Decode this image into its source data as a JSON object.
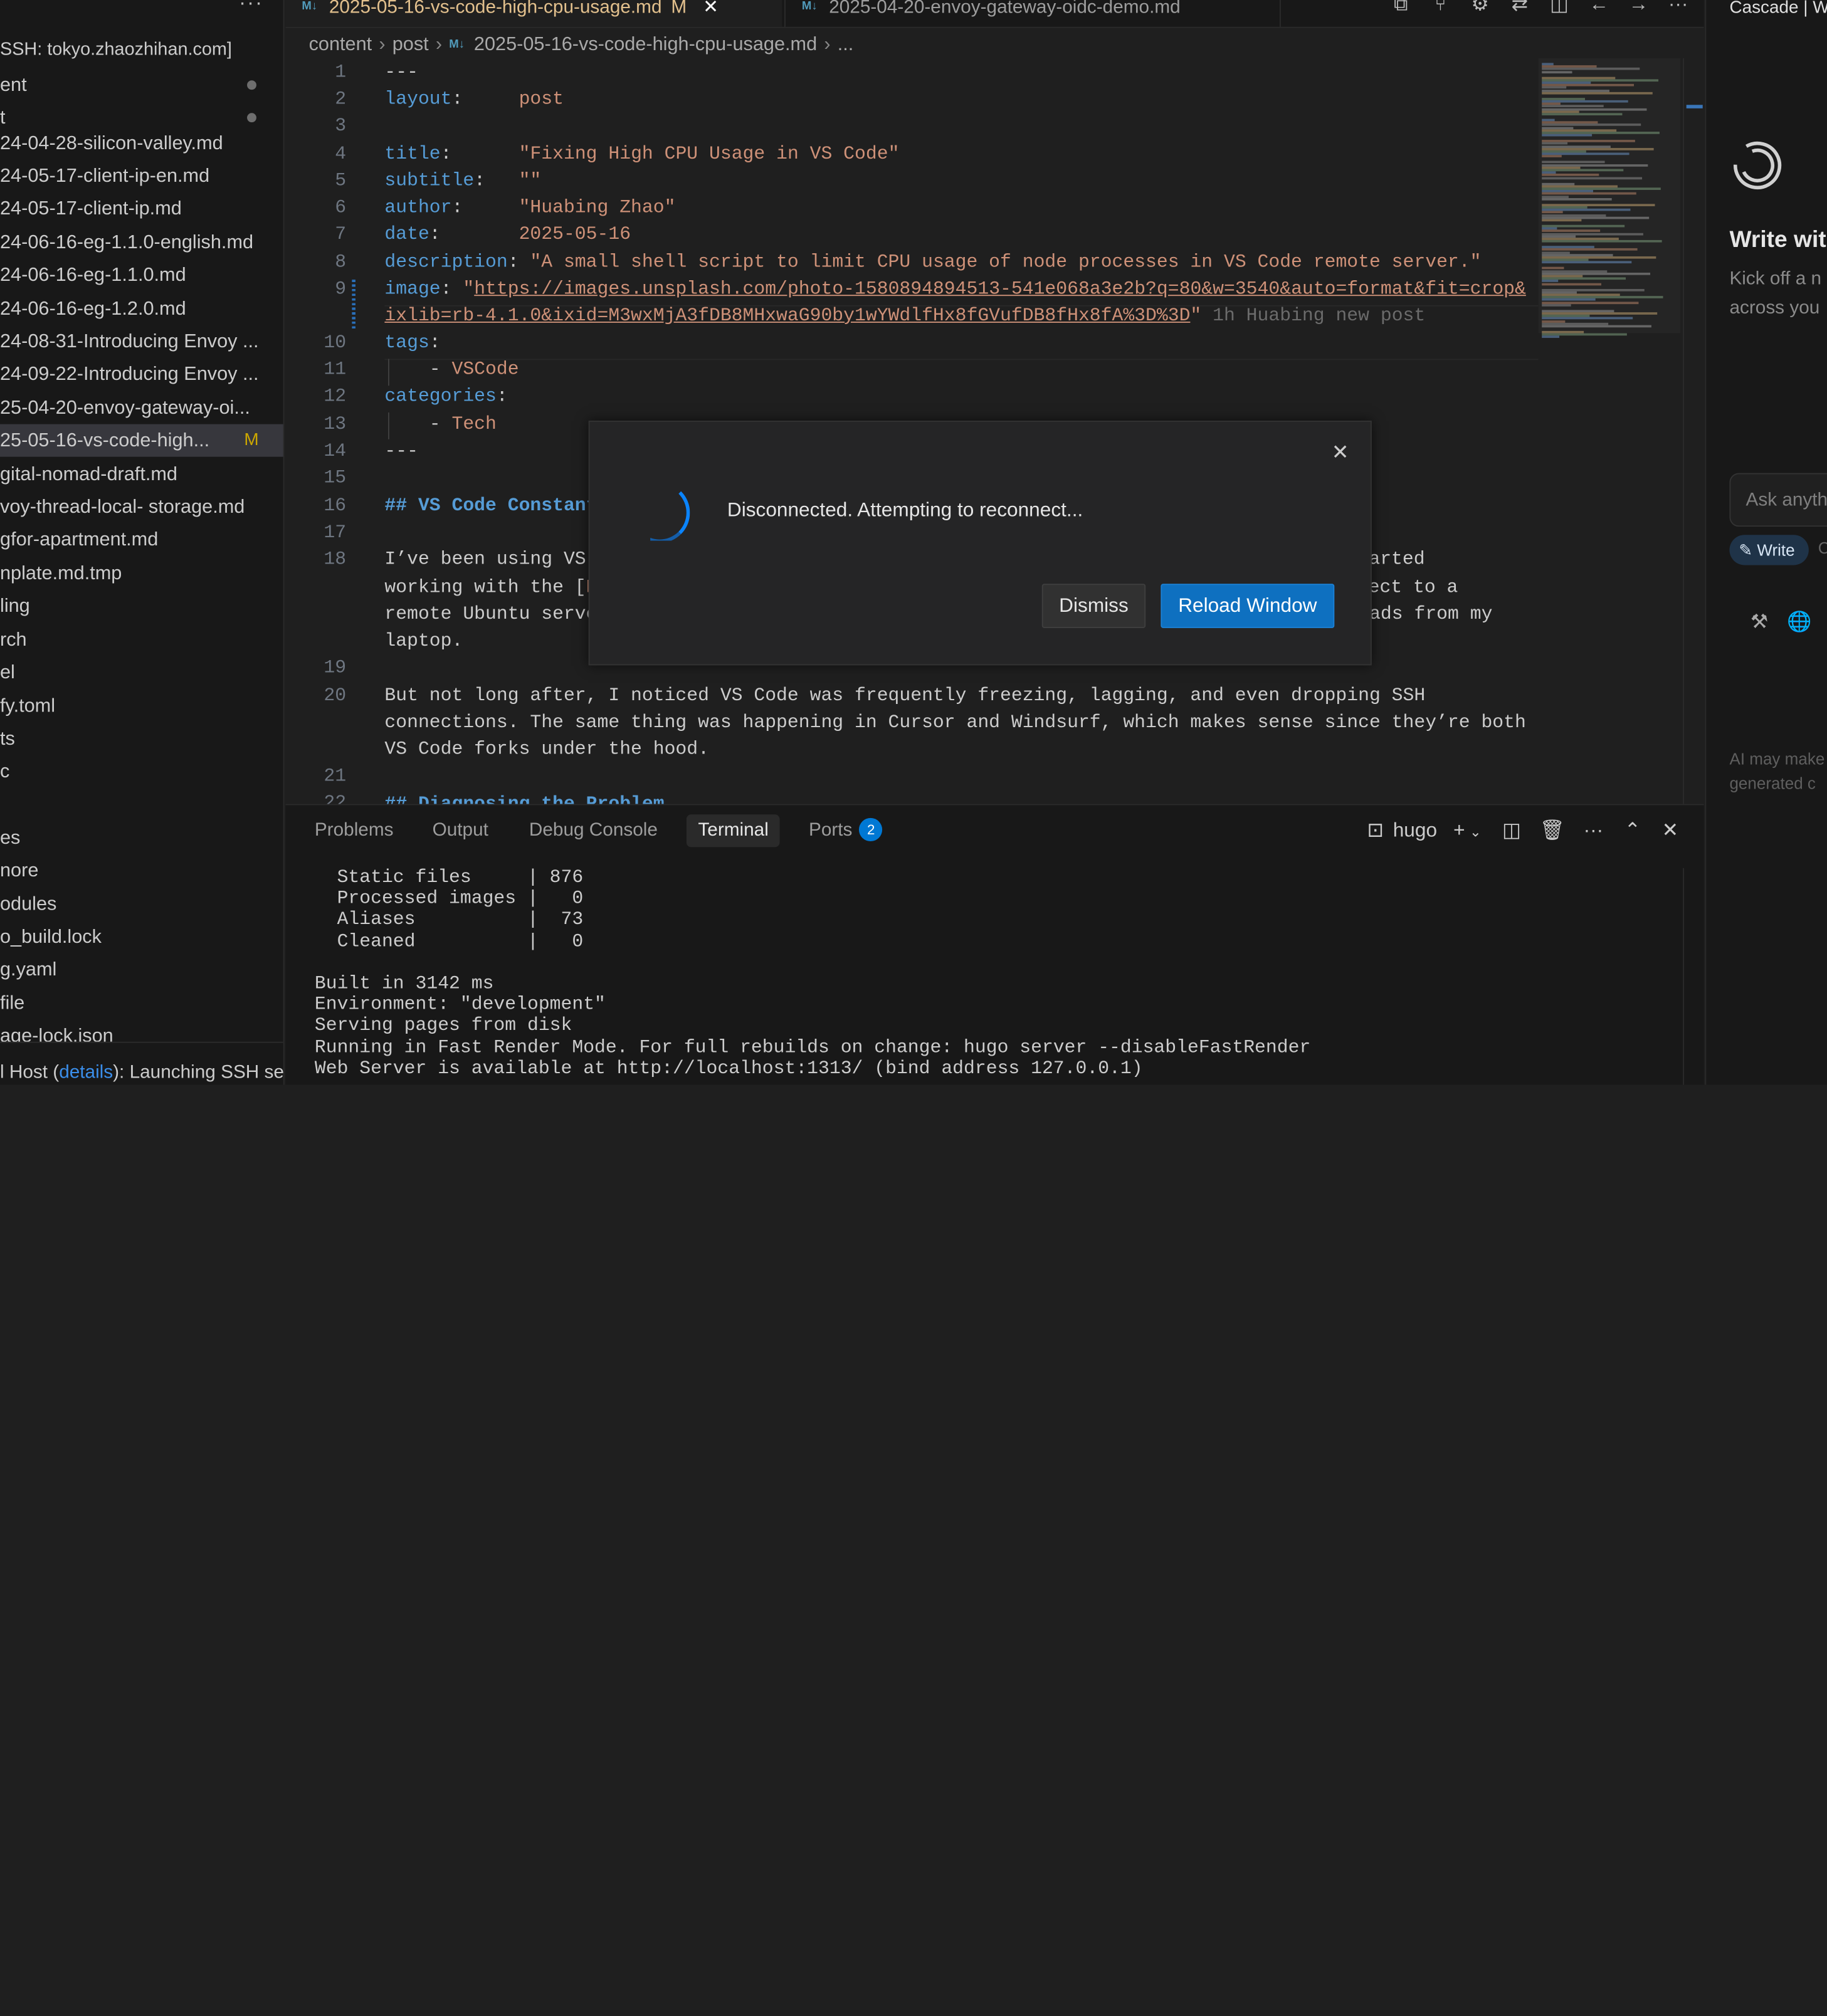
{
  "sidebar": {
    "title": "SSH: tokyo.zhaozhihan.com]",
    "items": [
      {
        "label": "ent"
      },
      {
        "label": "t"
      },
      {
        "label": "24-04-28-silicon-valley.md"
      },
      {
        "label": "24-05-17-client-ip-en.md"
      },
      {
        "label": "24-05-17-client-ip.md"
      },
      {
        "label": "24-06-16-eg-1.1.0-english.md"
      },
      {
        "label": "24-06-16-eg-1.1.0.md"
      },
      {
        "label": "24-06-16-eg-1.2.0.md"
      },
      {
        "label": "24-08-31-Introducing Envoy ..."
      },
      {
        "label": "24-09-22-Introducing Envoy ..."
      },
      {
        "label": "25-04-20-envoy-gateway-oi..."
      },
      {
        "label": "25-05-16-vs-code-high...",
        "badge": "M"
      },
      {
        "label": "gital-nomad-draft.md"
      },
      {
        "label": "voy-thread-local- storage.md"
      },
      {
        "label": "gfor-apartment.md"
      },
      {
        "label": "nplate.md.tmp"
      },
      {
        "label": "ling"
      },
      {
        "label": "rch"
      },
      {
        "label": "el"
      },
      {
        "label": "fy.toml"
      },
      {
        "label": "ts"
      },
      {
        "label": "c"
      },
      {
        "label": "es"
      },
      {
        "label": "nore"
      },
      {
        "label": "odules"
      },
      {
        "label": "o_build.lock"
      },
      {
        "label": "g.yaml"
      },
      {
        "label": "file"
      },
      {
        "label": "age-lock.json"
      }
    ],
    "status_prefix": "l Host (",
    "status_link": "details",
    "status_suffix": "): Launching SSH server..."
  },
  "tabs": [
    {
      "icon": "M↓",
      "label": "2025-05-16-vs-code-high-cpu-usage.md",
      "modified": "M",
      "close": "✕"
    },
    {
      "icon": "M↓",
      "label": "2025-04-20-envoy-gateway-oidc-demo.md"
    }
  ],
  "breadcrumb": {
    "parts": [
      "content",
      "post"
    ],
    "file": "2025-05-16-vs-code-high-cpu-usage.md",
    "tail": "..."
  },
  "editor": {
    "line_numbers": [
      "1",
      "2",
      "3",
      "4",
      "5",
      "6",
      "7",
      "8",
      "9",
      "10",
      "11",
      "12",
      "13",
      "14",
      "15",
      "16",
      "17",
      "18",
      "19",
      "20",
      "21",
      "22"
    ],
    "l1": "---",
    "l2_key": "layout",
    "l2_val": "post",
    "l4_key": "title",
    "l4_val": "\"Fixing High CPU Usage in VS Code\"",
    "l5_key": "subtitle",
    "l5_val": "\"\"",
    "l6_key": "author",
    "l6_val": "\"Huabing Zhao\"",
    "l7_key": "date",
    "l7_val": "2025-05-16",
    "l8_key": "description",
    "l8_val": "\"A small shell script to limit CPU usage of node processes in VS Code remote server.\"",
    "l9_key": "image",
    "l9_url1": "https://images.unsplash.com/photo-1580894894513-541e068a3e2b?q=80&w=3540&auto=format&fit=crop&",
    "l9_url2": "ixlib=rb-4.1.0&ixid=M3wxMjA3fDB8MHxwaG90by1wYWdlfHx8fGVufDB8fHx8fA%3D%3D",
    "l9_blame": "1h Huabing new post",
    "l10_key": "tags",
    "l11_val": "VSCode",
    "l12_key": "categories",
    "l13_val": "Tech",
    "l14": "---",
    "l16": "## VS Code Constant",
    "l18a_pre": "I’ve been using VS",
    "l18a_post": "tarted",
    "l18b_pre": "working with the [",
    "l18b_mid": "R",
    "l18b_post": "nnect to a",
    "l18c_pre": "remote Ubuntu serve",
    "l18c_post": "ads from my",
    "l18d": "laptop.",
    "l20a": "But not long after, I noticed VS Code was frequently freezing, lagging, and even dropping SSH",
    "l20b": "connections. The same thing was happening in Cursor and Windsurf, which makes sense since they’re both",
    "l20c": "VS Code forks under the hood.",
    "l22": "## Diagnosing the Problem"
  },
  "panel": {
    "tabs": [
      "Problems",
      "Output",
      "Debug Console",
      "Terminal",
      "Ports"
    ],
    "ports_count": "2",
    "terminal_name": "hugo",
    "terminal_text": "  Static files     | 876\n  Processed images |   0\n  Aliases          |  73\n  Cleaned          |   0\n\nBuilt in 3142 ms\nEnvironment: \"development\"\nServing pages from disk\nRunning in Fast Render Mode. For full rebuilds on change: hugo server --disableFastRender\nWeb Server is available at http://localhost:1313/ (bind address 127.0.0.1)"
  },
  "right_pane": {
    "title": "Cascade | W",
    "heading": "Write wit",
    "sub1": "Kick off a n",
    "sub2": "across you",
    "ask_placeholder": "Ask anyth",
    "write_button": "Write",
    "mode_hint": "C",
    "ai_note1": "AI may make",
    "ai_note2": "generated c"
  },
  "modal": {
    "message": "Disconnected. Attempting to reconnect...",
    "dismiss": "Dismiss",
    "reload": "Reload Window"
  },
  "colors": {
    "accent": "#0e70c0",
    "keyword": "#569cd6",
    "string": "#ce9178",
    "modified": "#e2c08d"
  }
}
